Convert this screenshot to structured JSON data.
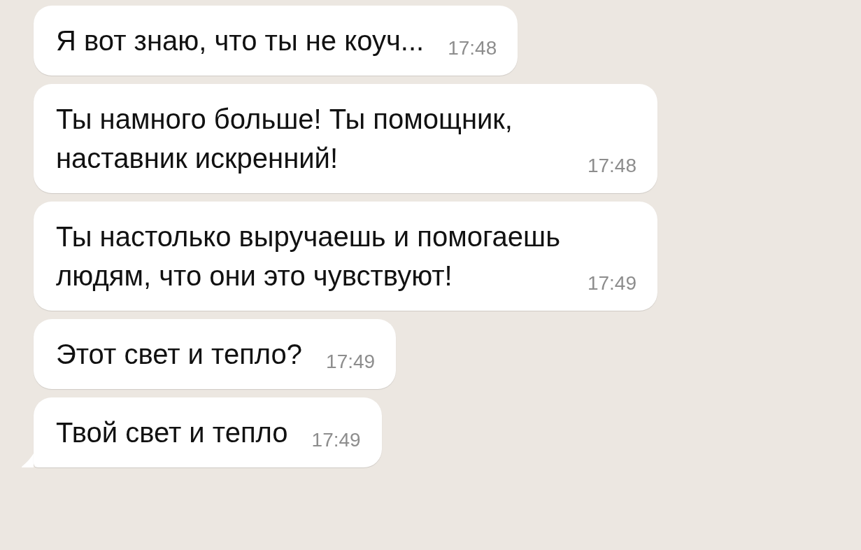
{
  "messages": [
    {
      "text": "Я вот знаю, что ты не коуч...",
      "time": "17:48",
      "tail": false
    },
    {
      "text": "Ты намного больше! Ты помощник, наставник искренний!",
      "time": "17:48",
      "tail": false
    },
    {
      "text": "Ты настолько выручаешь и помогаешь людям, что они это чувствуют!",
      "time": "17:49",
      "tail": false
    },
    {
      "text": "Этот свет и тепло?",
      "time": "17:49",
      "tail": false
    },
    {
      "text": "Твой свет и тепло",
      "time": "17:49",
      "tail": true
    }
  ]
}
